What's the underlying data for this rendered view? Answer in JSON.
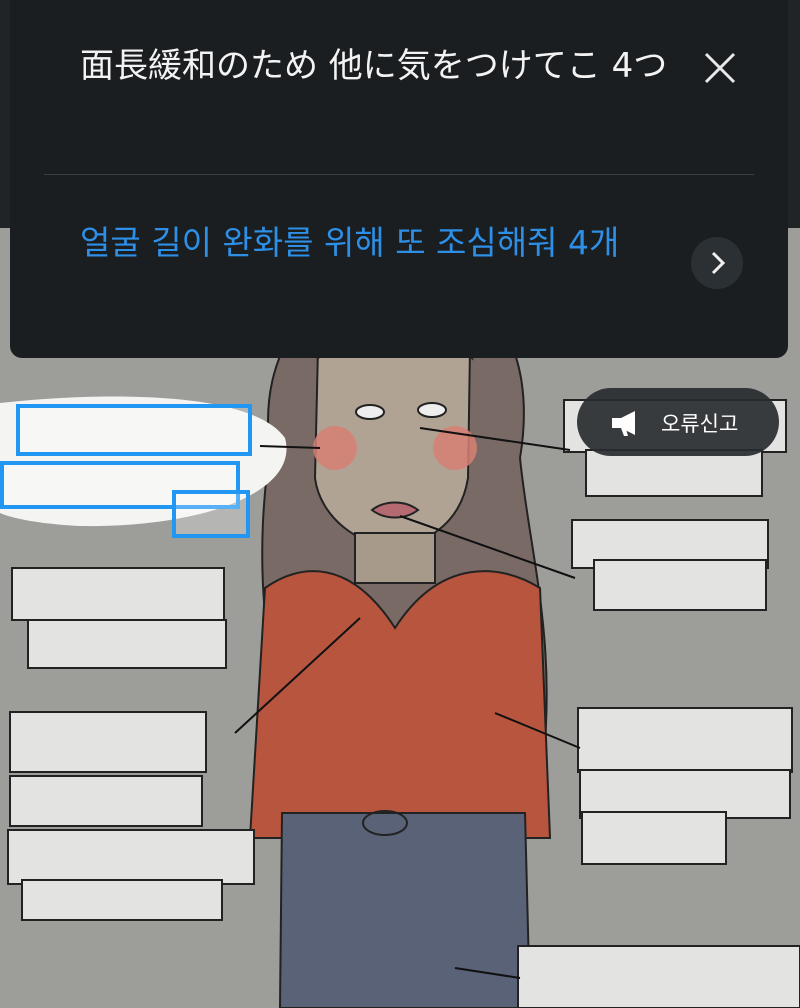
{
  "translation_panel": {
    "original_text": "面長緩和のため 他に気をつけてこ 4つ",
    "translated_text": "얼굴 길이 완화를 위해 또 조심해줘 4개"
  },
  "report_button": {
    "label": "오류신고"
  },
  "icons": {
    "close": "close-icon",
    "next": "chevron-right-icon",
    "report": "megaphone-icon"
  },
  "colors": {
    "panel_bg": "#1a1e21",
    "translated_text": "#2e8fe6",
    "highlight_box": "#2196f3"
  }
}
